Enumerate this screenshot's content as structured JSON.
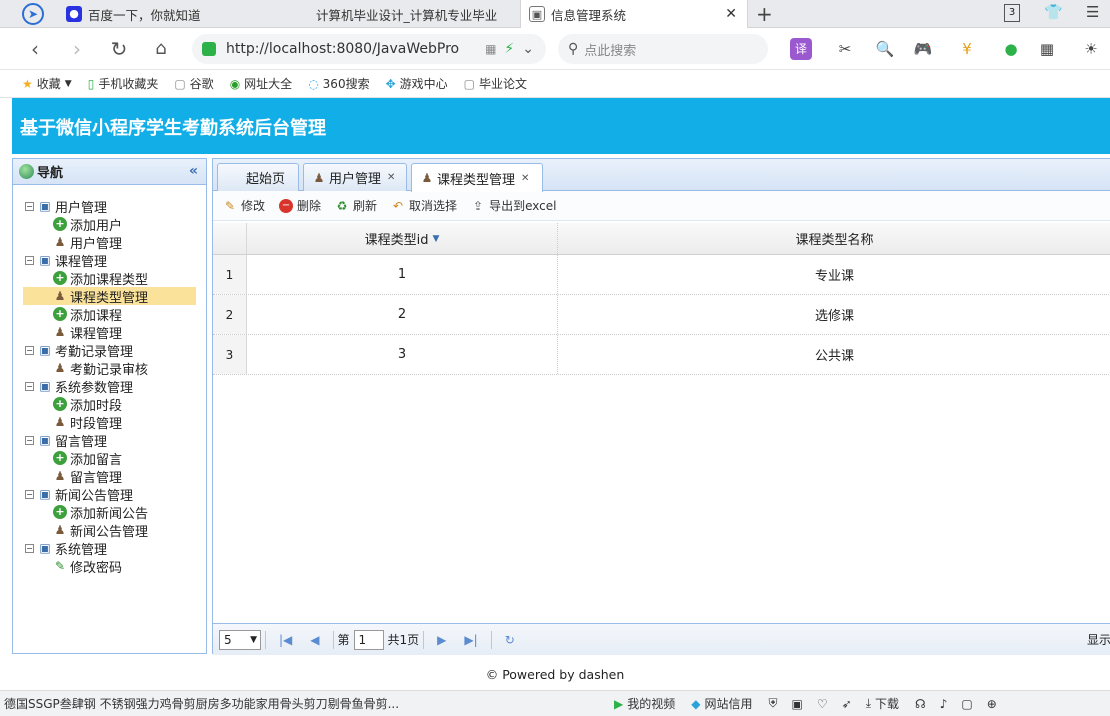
{
  "browser": {
    "tabs": [
      {
        "label": "百度一下，你就知道",
        "icon": "baidu-paw-icon"
      },
      {
        "label": "计算机毕业设计_计算机专业毕业",
        "icon": "page-icon"
      },
      {
        "label": "信息管理系统",
        "icon": "page-icon",
        "active": true
      }
    ],
    "tab_count": "3",
    "address": "http://localhost:8080/JavaWebPro",
    "search_placeholder": "点此搜索",
    "bookmarks": [
      {
        "label": "收藏",
        "icon": "star-icon"
      },
      {
        "label": "手机收藏夹",
        "icon": "phone-icon"
      },
      {
        "label": "谷歌",
        "icon": "page-icon"
      },
      {
        "label": "网址大全",
        "icon": "globe-icon"
      },
      {
        "label": "360搜索",
        "icon": "search-360-icon"
      },
      {
        "label": "游戏中心",
        "icon": "game-icon"
      },
      {
        "label": "毕业论文",
        "icon": "page-icon"
      }
    ]
  },
  "app": {
    "title": "基于微信小程序学生考勤系统后台管理"
  },
  "sidebar": {
    "title": "导航",
    "tree": [
      {
        "label": "用户管理",
        "level": 0,
        "icon": "folder"
      },
      {
        "label": "添加用户",
        "level": 1,
        "icon": "add"
      },
      {
        "label": "用户管理",
        "level": 1,
        "icon": "user"
      },
      {
        "label": "课程管理",
        "level": 0,
        "icon": "folder"
      },
      {
        "label": "添加课程类型",
        "level": 1,
        "icon": "add"
      },
      {
        "label": "课程类型管理",
        "level": 1,
        "icon": "user",
        "selected": true
      },
      {
        "label": "添加课程",
        "level": 1,
        "icon": "add"
      },
      {
        "label": "课程管理",
        "level": 1,
        "icon": "user"
      },
      {
        "label": "考勤记录管理",
        "level": 0,
        "icon": "folder"
      },
      {
        "label": "考勤记录审核",
        "level": 1,
        "icon": "user"
      },
      {
        "label": "系统参数管理",
        "level": 0,
        "icon": "folder"
      },
      {
        "label": "添加时段",
        "level": 1,
        "icon": "add"
      },
      {
        "label": "时段管理",
        "level": 1,
        "icon": "user"
      },
      {
        "label": "留言管理",
        "level": 0,
        "icon": "folder"
      },
      {
        "label": "添加留言",
        "level": 1,
        "icon": "add"
      },
      {
        "label": "留言管理",
        "level": 1,
        "icon": "user"
      },
      {
        "label": "新闻公告管理",
        "level": 0,
        "icon": "folder"
      },
      {
        "label": "添加新闻公告",
        "level": 1,
        "icon": "add"
      },
      {
        "label": "新闻公告管理",
        "level": 1,
        "icon": "user"
      },
      {
        "label": "系统管理",
        "level": 0,
        "icon": "folder"
      },
      {
        "label": "修改密码",
        "level": 1,
        "icon": "pen"
      }
    ]
  },
  "main": {
    "tabs": [
      {
        "label": "起始页",
        "closable": false
      },
      {
        "label": "用户管理",
        "closable": true
      },
      {
        "label": "课程类型管理",
        "closable": true,
        "active": true
      }
    ],
    "toolbar": {
      "edit": "修改",
      "delete": "删除",
      "refresh": "刷新",
      "deselect": "取消选择",
      "export": "导出到excel"
    },
    "grid": {
      "columns": [
        "课程类型id",
        "课程类型名称"
      ],
      "rows": [
        {
          "num": "1",
          "id": "1",
          "name": "专业课"
        },
        {
          "num": "2",
          "id": "2",
          "name": "选修课"
        },
        {
          "num": "3",
          "id": "3",
          "name": "公共课"
        }
      ]
    },
    "pager": {
      "page_size": "5",
      "page_prefix": "第",
      "page_value": "1",
      "page_total": "共1页",
      "display_label": "显示"
    }
  },
  "footer": {
    "text": "© Powered by dashen"
  },
  "statusbar": {
    "ad_text": "德国SSGP叁肆钢 不锈钢强力鸡骨剪厨房多功能家用骨头剪刀剔骨鱼骨剪...",
    "items": [
      "我的视频",
      "网站信用",
      "下载"
    ]
  },
  "colors": {
    "header_bg": "#11aee7",
    "panel_border": "#99bbe8",
    "selected_bg": "#fbe29a"
  }
}
